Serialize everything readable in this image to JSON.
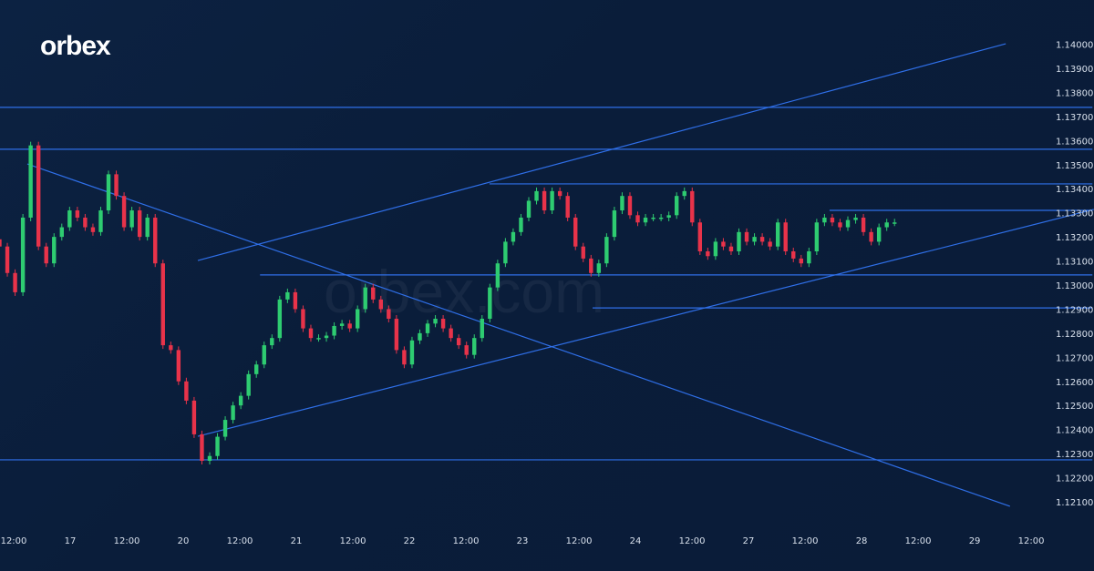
{
  "brand": {
    "logo": "orbex",
    "watermark": "orbex.com"
  },
  "colors": {
    "background": "#0a1e3b",
    "line": "#2f6fe8",
    "up": "#2ecc71",
    "down": "#e8334a",
    "text": "#d8e0ec"
  },
  "chart_data": {
    "type": "candlestick",
    "title": "",
    "y_ticks": [
      "1.14000",
      "1.13900",
      "1.13800",
      "1.13700",
      "1.13600",
      "1.13500",
      "1.13400",
      "1.13300",
      "1.13200",
      "1.13100",
      "1.13000",
      "1.12900",
      "1.12800",
      "1.12700",
      "1.12600",
      "1.12500",
      "1.12400",
      "1.12300",
      "1.12200",
      "1.12100"
    ],
    "ylim": [
      1.1205,
      1.1402
    ],
    "x_ticks": [
      "12:00",
      "17",
      "12:00",
      "20",
      "12:00",
      "21",
      "12:00",
      "22",
      "12:00",
      "23",
      "12:00",
      "24",
      "12:00",
      "27",
      "12:00",
      "28",
      "12:00",
      "29",
      "12:00"
    ],
    "x_time_unit": "hours since first 12:00 label",
    "closes_time_range_hours": [
      -3,
      187
    ],
    "closes": [
      1.1316,
      1.1305,
      1.1297,
      1.1328,
      1.1358,
      1.1316,
      1.1309,
      1.132,
      1.1324,
      1.1331,
      1.1328,
      1.1324,
      1.1322,
      1.1331,
      1.1346,
      1.1337,
      1.1324,
      1.1331,
      1.132,
      1.1328,
      1.1309,
      1.1275,
      1.1273,
      1.126,
      1.1252,
      1.1238,
      1.1227,
      1.1229,
      1.1237,
      1.1244,
      1.125,
      1.1254,
      1.1263,
      1.1267,
      1.1275,
      1.1278,
      1.1294,
      1.1297,
      1.129,
      1.1282,
      1.1278,
      1.1278,
      1.1279,
      1.1283,
      1.1284,
      1.1282,
      1.129,
      1.1299,
      1.1294,
      1.129,
      1.1286,
      1.1273,
      1.1267,
      1.1277,
      1.128,
      1.1284,
      1.1286,
      1.1282,
      1.1278,
      1.1275,
      1.1271,
      1.1278,
      1.1286,
      1.1299,
      1.1309,
      1.1318,
      1.1322,
      1.1328,
      1.1335,
      1.1339,
      1.1331,
      1.1339,
      1.1337,
      1.1328,
      1.1316,
      1.1311,
      1.1305,
      1.1309,
      1.132,
      1.1331,
      1.1337,
      1.1329,
      1.1326,
      1.1328,
      1.1328,
      1.1328,
      1.1329,
      1.1337,
      1.1339,
      1.1326,
      1.1314,
      1.1312,
      1.1318,
      1.1316,
      1.1314,
      1.1322,
      1.1318,
      1.132,
      1.1318,
      1.1316,
      1.1326,
      1.1314,
      1.1311,
      1.1309,
      1.1314,
      1.1326,
      1.1328,
      1.1326,
      1.1324,
      1.1327,
      1.1328,
      1.1322,
      1.1318,
      1.1324,
      1.1326,
      1.1326
    ],
    "lines": [
      {
        "name": "resistance-1.1374",
        "from": [
          -3,
          1.13738
        ],
        "to": [
          229,
          1.13738
        ]
      },
      {
        "name": "resistance-1.1356",
        "from": [
          -3,
          1.13564
        ],
        "to": [
          229,
          1.13564
        ]
      },
      {
        "name": "range-top",
        "from": [
          101,
          1.1342
        ],
        "to": [
          229,
          1.1342
        ]
      },
      {
        "name": "range-upper",
        "from": [
          173.2,
          1.1331
        ],
        "to": [
          229,
          1.1331
        ]
      },
      {
        "name": "support-1.1304",
        "from": [
          52.3,
          1.13042
        ],
        "to": [
          229,
          1.13042
        ]
      },
      {
        "name": "support-1.1290",
        "from": [
          122.9,
          1.12905
        ],
        "to": [
          229,
          1.12905
        ]
      },
      {
        "name": "support-1.1227",
        "from": [
          -3,
          1.12274
        ],
        "to": [
          229,
          1.12274
        ]
      },
      {
        "name": "channel-upper",
        "from": [
          39.1,
          1.13102
        ],
        "to": [
          210.6,
          1.14002
        ]
      },
      {
        "name": "channel-lower",
        "from": [
          39.1,
          1.12372
        ],
        "to": [
          229.3,
          1.13314
        ]
      },
      {
        "name": "descending-trendline",
        "from": [
          2.9,
          1.13503
        ],
        "to": [
          211.5,
          1.12081
        ]
      }
    ]
  }
}
